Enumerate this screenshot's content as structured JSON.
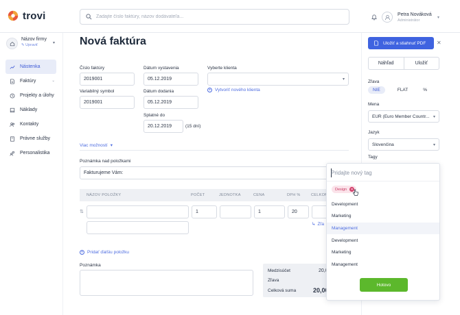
{
  "brand": {
    "name": "trovi"
  },
  "search": {
    "placeholder": "Zadajte číslo faktúry, názov dodávateľa..."
  },
  "user": {
    "name": "Petra Nováková",
    "role": "Administrátor"
  },
  "company": {
    "name": "Názov firmy",
    "edit_label": "Upraviť"
  },
  "sidebar": {
    "items": [
      {
        "label": "Nástenka",
        "icon": "trend-icon",
        "active": true
      },
      {
        "label": "Faktúry",
        "icon": "document-icon",
        "has_caret": true
      },
      {
        "label": "Projekty a úlohy",
        "icon": "clock-icon"
      },
      {
        "label": "Náklady",
        "icon": "book-icon"
      },
      {
        "label": "Kontakty",
        "icon": "contacts-icon"
      },
      {
        "label": "Právne služby",
        "icon": "law-icon"
      },
      {
        "label": "Personalistika",
        "icon": "people-icon"
      }
    ]
  },
  "page": {
    "title": "Nová faktúra"
  },
  "invoice": {
    "number_label": "Číslo faktúry",
    "number_value": "2019001",
    "issue_label": "Dátum vystavenia",
    "issue_value": "05.12.2019",
    "client_label": "Vyberte klienta",
    "client_value": "",
    "create_client_link": "Vytvoriť nového klienta",
    "variable_label": "Variabilný symbol",
    "variable_value": "2019001",
    "delivery_label": "Dátum dodania",
    "delivery_value": "05.12.2019",
    "due_label": "Splatné do",
    "due_value": "20.12.2019",
    "due_days": "(15 dní)",
    "more_options": "Viac možností",
    "note_above_label": "Poznámka nad položkami",
    "note_above_value": "Fakturujeme Vám:"
  },
  "items_table": {
    "headers": [
      "NÁZOV POLOŽKY",
      "POČET",
      "JEDNOTKA",
      "CENA",
      "DPH %",
      "CELKOM"
    ],
    "row": {
      "qty": "1",
      "unit": "",
      "price": "1",
      "vat": "20"
    },
    "row_link_text": "Zľa",
    "add_item": "Pridať ďalšiu položku"
  },
  "note": {
    "label": "Poznámka"
  },
  "summary": {
    "subtotal_label": "Medzisúčet",
    "subtotal_value": "20,0",
    "discount_label": "Zľava",
    "total_label": "Celková suma",
    "total_value": "20,00"
  },
  "right": {
    "save_pdf": "Uložiť a stiahnuť PDF",
    "preview": "Náhľad",
    "save": "Uložiť",
    "discount_label": "Zľava",
    "discount_options": [
      "NIE",
      "FLAT",
      "%"
    ],
    "currency_label": "Mena",
    "currency_value": "EUR (Euro Member Countr...",
    "language_label": "Jazyk",
    "language_value": "Slovenčina",
    "tags_label": "Tagy"
  },
  "tags_dropdown": {
    "placeholder": "Pridajte nový tag",
    "selected": [
      "Design"
    ],
    "options": [
      "Development",
      "Marketing",
      "Management",
      "Development",
      "Marketing",
      "Management"
    ],
    "highlighted_index": 2,
    "done": "Hotovo"
  },
  "colors": {
    "accent": "#3f63e0",
    "success": "#5cb82c",
    "tag_pink": "#d23d6a"
  }
}
